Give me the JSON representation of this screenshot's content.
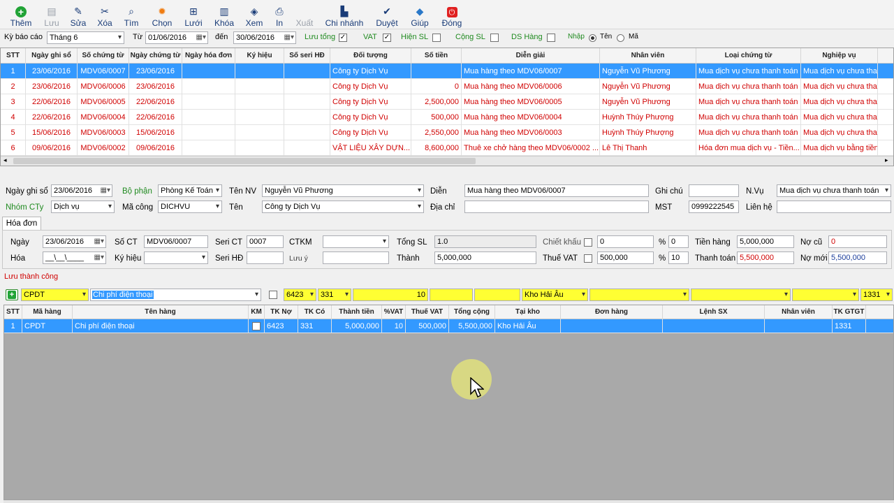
{
  "toolbar": [
    {
      "label": "Thêm",
      "icon": "add-icon",
      "color": "#21a336"
    },
    {
      "label": "Lưu",
      "icon": "save-icon",
      "disabled": true
    },
    {
      "label": "Sửa",
      "icon": "edit-icon"
    },
    {
      "label": "Xóa",
      "icon": "delete-icon"
    },
    {
      "label": "Tìm",
      "icon": "find-icon"
    },
    {
      "label": "Chọn",
      "icon": "select-icon",
      "color": "#f07d12"
    },
    {
      "label": "Lưới",
      "icon": "grid-icon"
    },
    {
      "label": "Khóa",
      "icon": "lock-icon"
    },
    {
      "label": "Xem",
      "icon": "view-icon"
    },
    {
      "label": "In",
      "icon": "print-icon"
    },
    {
      "label": "Xuất",
      "icon": "export-icon",
      "disabled": true
    },
    {
      "label": "Chi nhánh",
      "icon": "branch-icon"
    },
    {
      "label": "Duyệt",
      "icon": "approve-icon"
    },
    {
      "label": "Giúp",
      "icon": "help-icon"
    },
    {
      "label": "Đóng",
      "icon": "close-icon",
      "color": "#e02020"
    }
  ],
  "filter": {
    "period_label": "Kỳ báo cáo",
    "period_value": "Tháng 6",
    "from_label": "Từ",
    "from_value": "01/06/2016",
    "to_label": "đến",
    "to_value": "30/06/2016",
    "save_total_label": "Lưu tổng",
    "vat_label": "VAT",
    "show_qty_label": "Hiện SL",
    "sum_qty_label": "Cộng SL",
    "item_list_label": "DS Hàng",
    "input_label": "Nhập",
    "name_label": "Tên",
    "code_label": "Mã"
  },
  "main_grid": {
    "columns": [
      "STT",
      "Ngày ghi sổ",
      "Số chứng từ",
      "Ngày chứng từ",
      "Ngày hóa đơn",
      "Ký hiệu",
      "Số seri HĐ",
      "Đối tượng",
      "Số tiền",
      "Diễn giải",
      "Nhân viên",
      "Loại chứng từ",
      "Nghiệp vụ"
    ],
    "rows": [
      [
        "1",
        "23/06/2016",
        "MDV06/0007",
        "23/06/2016",
        "",
        "",
        "",
        "Công ty Dịch Vụ",
        "",
        "Mua hàng theo MDV06/0007",
        "Nguyễn Vũ Phương",
        "Mua dịch vụ chưa thanh toán",
        "Mua dịch vụ chưa tha"
      ],
      [
        "2",
        "23/06/2016",
        "MDV06/0006",
        "23/06/2016",
        "",
        "",
        "",
        "Công ty Dịch Vụ",
        "0",
        "Mua hàng theo MDV06/0006",
        "Nguyễn Vũ Phương",
        "Mua dịch vụ chưa thanh toán",
        "Mua dịch vụ chưa tha"
      ],
      [
        "3",
        "22/06/2016",
        "MDV06/0005",
        "22/06/2016",
        "",
        "",
        "",
        "Công ty Dịch Vụ",
        "2,500,000",
        "Mua hàng theo MDV06/0005",
        "Nguyễn Vũ Phương",
        "Mua dịch vụ chưa thanh toán",
        "Mua dịch vụ chưa tha"
      ],
      [
        "4",
        "22/06/2016",
        "MDV06/0004",
        "22/06/2016",
        "",
        "",
        "",
        "Công ty Dịch Vụ",
        "500,000",
        "Mua hàng theo MDV06/0004",
        "Huỳnh Thúy Phượng",
        "Mua dịch vụ chưa thanh toán",
        "Mua dịch vụ chưa tha"
      ],
      [
        "5",
        "15/06/2016",
        "MDV06/0003",
        "15/06/2016",
        "",
        "",
        "",
        "Công ty Dịch Vụ",
        "2,550,000",
        "Mua hàng theo MDV06/0003",
        "Huỳnh Thúy Phượng",
        "Mua dịch vụ chưa thanh toán",
        "Mua dịch vụ chưa tha"
      ],
      [
        "6",
        "09/06/2016",
        "MDV06/0002",
        "09/06/2016",
        "",
        "",
        "",
        "VẬT LIỆU XÂY DỰN...",
        "8,600,000",
        "Thuê xe chở hàng theo MDV06/0002 ...",
        "Lê Thị Thanh",
        "Hóa đơn mua dịch vụ - Tiền...",
        "Mua dịch vụ bằng tiền"
      ]
    ]
  },
  "header_form": {
    "post_date_label": "Ngày ghi sổ",
    "post_date": "23/06/2016",
    "dept_label": "Bộ phận",
    "dept": "Phòng Kế Toán",
    "emp_label": "Tên NV",
    "emp": "Nguyễn Vũ Phương",
    "desc_label": "Diễn",
    "desc": "Mua hàng theo MDV06/0007",
    "note_label": "Ghi chú",
    "note": "",
    "op_label": "N.Vụ",
    "op": "Mua dịch vụ chưa thanh toán",
    "group_label": "Nhóm CTy",
    "group": "Dịch vụ",
    "comp_code_label": "Mã công",
    "comp_code": "DICHVU",
    "name_label": "Tên",
    "name": "Công ty Dịch Vụ",
    "addr_label": "Địa chỉ",
    "addr": "",
    "tax_label": "MST",
    "tax": "0999222545",
    "contact_label": "Liên hệ",
    "contact": ""
  },
  "invoice": {
    "tab": "Hóa đơn",
    "date_label": "Ngày",
    "date": "23/06/2016",
    "ct_no_label": "Số CT",
    "ct_no": "MDV06/0007",
    "ct_seri_label": "Seri CT",
    "ct_seri": "0007",
    "ctkm_label": "CTKM",
    "ctkm": "",
    "total_qty_label": "Tổng SL",
    "total_qty": "1.0",
    "discount_label": "Chiết khấu",
    "discount": "0",
    "pct": "%",
    "discount_pct": "0",
    "goods_label": "Tiền hàng",
    "goods": "5,000,000",
    "old_debt_label": "Nợ cũ",
    "old_debt": "0",
    "inv_label": "Hóa",
    "inv_date": "__\\__\\____",
    "symbol_label": "Ký hiệu",
    "symbol": "",
    "inv_seri_label": "Seri HĐ",
    "inv_seri": "",
    "memo_label": "Lưu ý",
    "memo": "",
    "amount_label": "Thành",
    "amount": "5,000,000",
    "vat_label": "Thuế VAT",
    "vat": "500,000",
    "vat_pct": "10",
    "pay_label": "Thanh toán",
    "pay": "5,500,000",
    "new_debt_label": "Nợ mới",
    "new_debt": "5,500,000"
  },
  "status": "Lưu thành công",
  "entry": {
    "code": "CPDT",
    "name": "Chi phí điện thoại",
    "debit": "6423",
    "credit": "331",
    "vat": "10",
    "warehouse": "Kho Hải Âu",
    "gtgt": "1331"
  },
  "detail_grid": {
    "columns": [
      "STT",
      "Mã hàng",
      "Tên hàng",
      "KM",
      "TK Nợ",
      "TK Có",
      "Thành tiền",
      "%VAT",
      "Thuế VAT",
      "Tổng cộng",
      "Tại kho",
      "Đơn hàng",
      "Lệnh SX",
      "Nhân viên",
      "TK GTGT"
    ],
    "rows": [
      [
        "1",
        "CPDT",
        "Chi phí điện thoại",
        "",
        "6423",
        "331",
        "5,000,000",
        "10",
        "500,000",
        "5,500,000",
        "Kho Hải Âu",
        "",
        "",
        "",
        "1331"
      ]
    ]
  },
  "colors": {
    "selection": "#3399ff",
    "red_text": "#d00000",
    "yellow": "#ffff33",
    "green_label": "#1f8a1f"
  }
}
